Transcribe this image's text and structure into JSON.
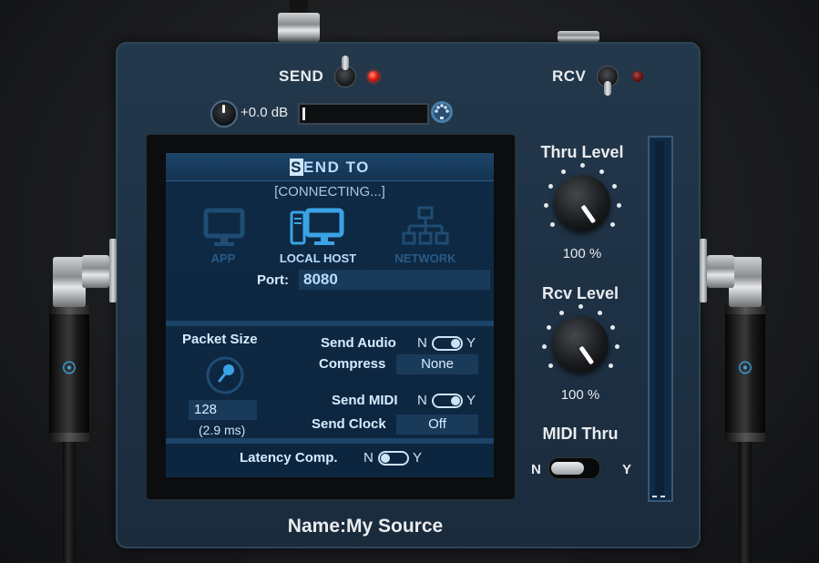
{
  "send": {
    "label": "SEND"
  },
  "rcv": {
    "label": "RCV"
  },
  "gain": {
    "value": "+0.0 dB"
  },
  "screen": {
    "title_first": "S",
    "title_rest": "END TO",
    "status": "[CONNECTING...]",
    "destinations": [
      {
        "label": "APP"
      },
      {
        "label": "LOCAL HOST"
      },
      {
        "label": "NETWORK"
      }
    ],
    "port_label": "Port:",
    "port_value": "8080",
    "packet_size_label": "Packet Size",
    "packet_size_value": "128",
    "packet_size_ms": "(2.9 ms)",
    "send_audio_label": "Send Audio",
    "compress_label": "Compress",
    "compress_value": "None",
    "send_midi_label": "Send MIDI",
    "send_clock_label": "Send Clock",
    "send_clock_value": "Off",
    "latency_label": "Latency Comp.",
    "n": "N",
    "y": "Y"
  },
  "thru_level": {
    "label": "Thru Level",
    "value": "100 %"
  },
  "rcv_level": {
    "label": "Rcv Level",
    "value": "100 %"
  },
  "midi_thru": {
    "label": "MIDI Thru",
    "n": "N",
    "y": "Y"
  },
  "name": {
    "label": "Name:My Source"
  },
  "colors": {
    "accent": "#3aa3e6",
    "led": "#e01b0e",
    "panel": "#1e3144"
  }
}
